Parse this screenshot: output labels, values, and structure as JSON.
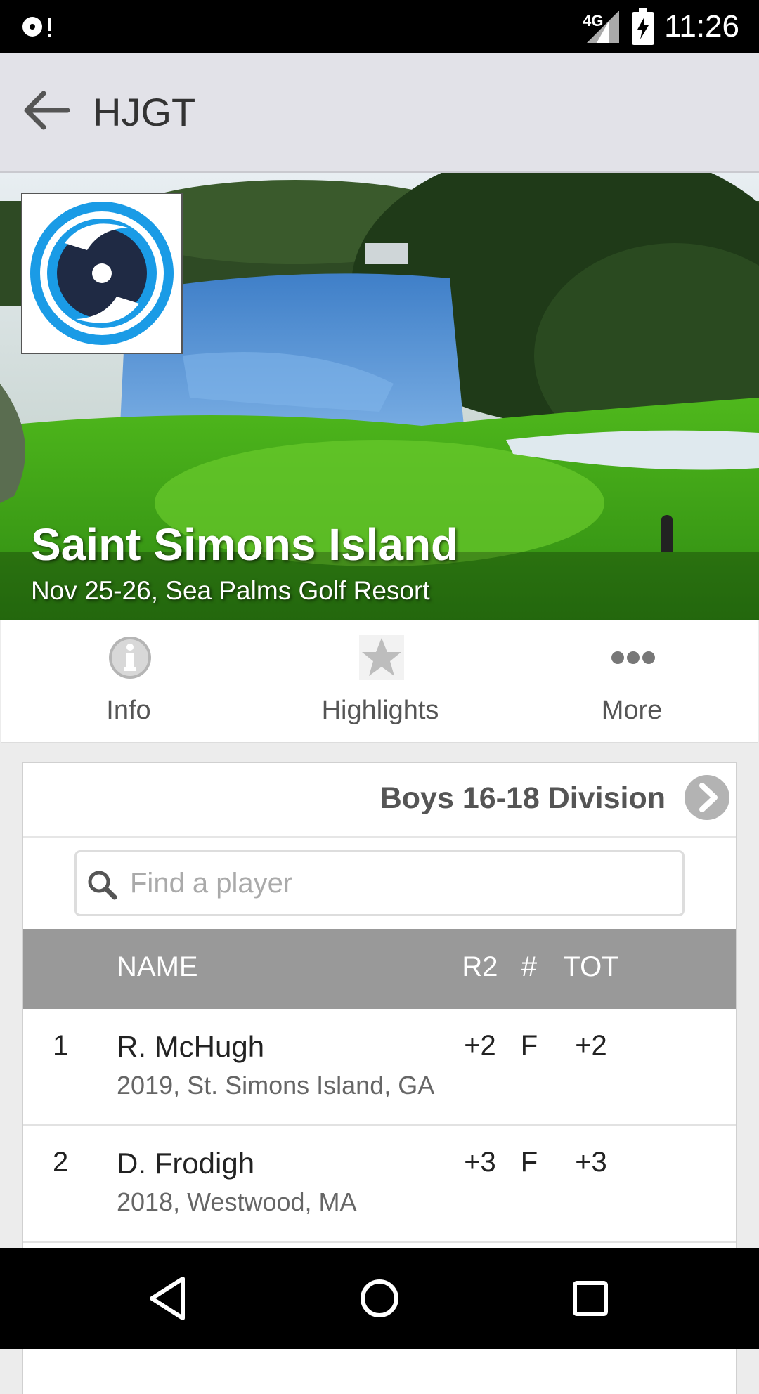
{
  "status_bar": {
    "network": "4G",
    "time": "11:26"
  },
  "app_bar": {
    "title": "HJGT"
  },
  "event": {
    "title": "Saint Simons Island",
    "subtitle": "Nov 25-26, Sea Palms Golf Resort"
  },
  "tabs": [
    {
      "label": "Info",
      "icon": "info-icon"
    },
    {
      "label": "Highlights",
      "icon": "star-icon"
    },
    {
      "label": "More",
      "icon": "more-dots-icon"
    }
  ],
  "leaderboard": {
    "division": "Boys 16-18 Division",
    "search_placeholder": "Find a player",
    "columns": {
      "name": "NAME",
      "round": "R2",
      "thru": "#",
      "total": "TOT"
    },
    "rows": [
      {
        "pos": "1",
        "name": "R. McHugh",
        "info": "2019, St. Simons Island, GA",
        "r2": "+2",
        "thru": "F",
        "tot": "+2"
      },
      {
        "pos": "2",
        "name": "D. Frodigh",
        "info": "2018, Westwood, MA",
        "r2": "+3",
        "thru": "F",
        "tot": "+3"
      }
    ]
  },
  "colors": {
    "logo_blue": "#1a9be6",
    "logo_navy": "#1f2a44",
    "header_gray": "#999999"
  }
}
